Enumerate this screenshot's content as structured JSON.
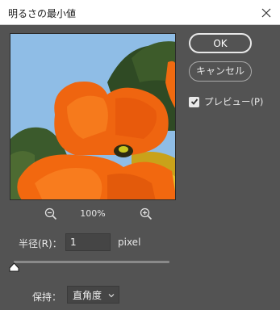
{
  "window": {
    "title": "明るさの最小値"
  },
  "zoom": {
    "level": "100%"
  },
  "buttons": {
    "ok_label": "OK",
    "cancel_label": "キャンセル"
  },
  "preview_checkbox": {
    "label": "プレビュー(P)",
    "checked": true
  },
  "radius": {
    "label": "半径(R)：",
    "value": "1",
    "unit": "pixel",
    "slider_position_fraction": 0
  },
  "preserve": {
    "label": "保持：",
    "selected": "直角度"
  },
  "icons": {
    "close": "close-icon",
    "zoom_out": "zoom-out-icon",
    "zoom_in": "zoom-in-icon",
    "check": "checkmark-icon",
    "dropdown": "chevron-down-icon",
    "slider": "slider-thumb-icon"
  },
  "colors": {
    "dialog_background": "#535353",
    "title_bar": "#ffffff",
    "field_background": "#454545",
    "poppy_orange": "#f26a0f",
    "sky_blue": "#8fbde6"
  }
}
